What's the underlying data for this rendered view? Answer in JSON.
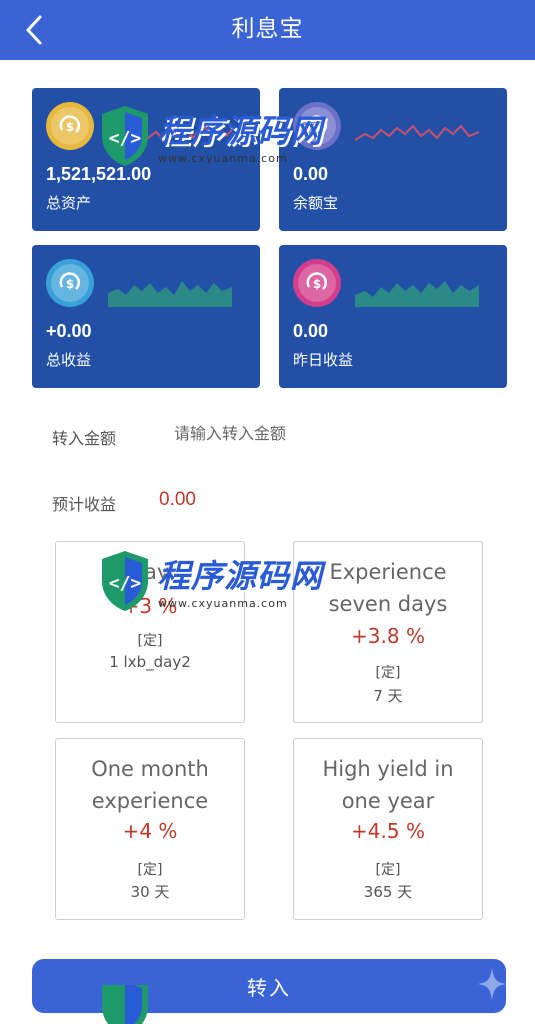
{
  "header": {
    "title": "利息宝"
  },
  "cards": [
    {
      "value": "1,521,521.00",
      "label": "总资产",
      "icon": "coin-dollar-icon",
      "icon_color": "#e6b83d",
      "spark_color": "#c8506a"
    },
    {
      "value": "0.00",
      "label": "余额宝",
      "icon": "coin-dollar-icon",
      "icon_color": "#6b70c8",
      "spark_color": "#c8506a"
    },
    {
      "value": "+0.00",
      "label": "总收益",
      "icon": "coin-dollar-icon",
      "icon_color": "#3aa0d8",
      "spark_color": "#2fa37a"
    },
    {
      "value": "0.00",
      "label": "昨日收益",
      "icon": "coin-dollar-icon",
      "icon_color": "#d43c8c",
      "spark_color": "#2fa37a"
    }
  ],
  "transfer": {
    "label": "转入金额",
    "placeholder": "请输入转入金额"
  },
  "estimate": {
    "label": "预计收益",
    "value": "0.00"
  },
  "plans": [
    {
      "name": "day",
      "rate": "+3 %",
      "type": "[定]",
      "days": "1 lxb_day2"
    },
    {
      "name": "Experience seven days",
      "rate": "+3.8 %",
      "type": "[定]",
      "days": "7 天"
    },
    {
      "name": "One month experience",
      "rate": "+4 %",
      "type": "[定]",
      "days": "30 天"
    },
    {
      "name": "High yield in one year",
      "rate": "+4.5 %",
      "type": "[定]",
      "days": "365 天"
    }
  ],
  "submit": {
    "label": "转入"
  },
  "watermark": {
    "text": "程序源码网",
    "url": "www.cxyuanma.com"
  },
  "colors": {
    "primary": "#3a63d6",
    "card": "#2350a7",
    "accent_red": "#c0392b"
  }
}
